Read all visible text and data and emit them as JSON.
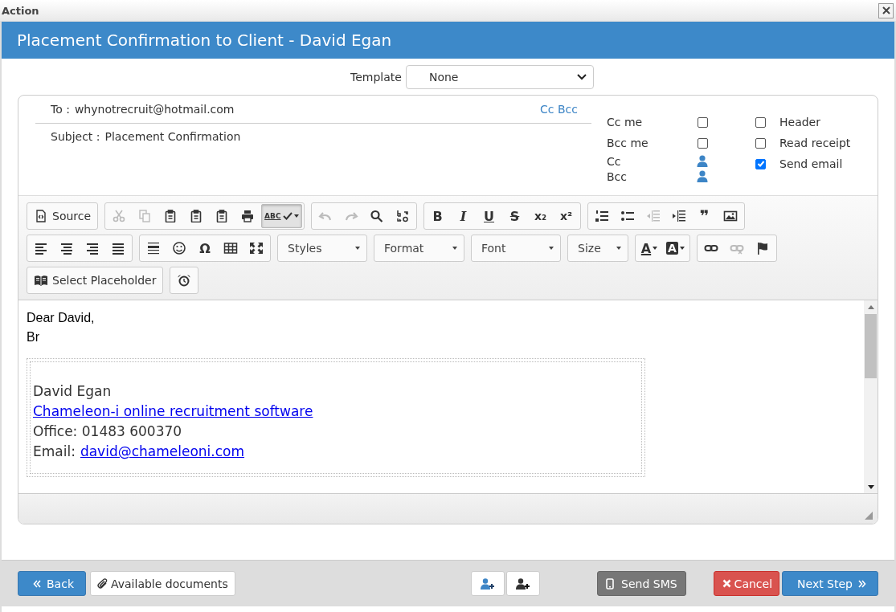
{
  "dialog": {
    "title": "Action"
  },
  "header": {
    "title": "Placement Confirmation to Client - David Egan"
  },
  "template": {
    "label": "Template",
    "value": "None"
  },
  "recipients": {
    "to_label": "To :",
    "to_value": "whynotrecruit@hotmail.com",
    "cc_bcc_link": "Cc Bcc",
    "subject_label": "Subject :",
    "subject_value": "Placement Confirmation"
  },
  "options_left": [
    {
      "label": "Cc me",
      "kind": "checkbox",
      "checked": false
    },
    {
      "label": "Bcc me",
      "kind": "checkbox",
      "checked": false
    },
    {
      "label": "Cc",
      "kind": "contact"
    },
    {
      "label": "Bcc",
      "kind": "contact"
    }
  ],
  "options_right": [
    {
      "label": "Header",
      "checked": false
    },
    {
      "label": "Read receipt",
      "checked": false
    },
    {
      "label": "Send email",
      "checked": true
    }
  ],
  "toolbar_rows": [
    [
      {
        "kind": "group",
        "items": [
          {
            "kind": "source",
            "label": "Source",
            "disabled": false,
            "on": false
          }
        ]
      },
      {
        "kind": "group",
        "items": [
          {
            "kind": "cut",
            "disabled": true,
            "on": false
          },
          {
            "kind": "copy",
            "disabled": true,
            "on": false
          },
          {
            "kind": "paste",
            "disabled": false,
            "on": false
          },
          {
            "kind": "paste-text",
            "disabled": false,
            "on": false
          },
          {
            "kind": "paste-word",
            "disabled": false,
            "on": false
          },
          {
            "kind": "print",
            "disabled": false,
            "on": false
          },
          {
            "kind": "spellcheck",
            "glyph": "ABC",
            "disabled": false,
            "on": true
          }
        ]
      },
      {
        "kind": "group",
        "items": [
          {
            "kind": "undo",
            "disabled": true,
            "on": false
          },
          {
            "kind": "redo",
            "disabled": true,
            "on": false
          },
          {
            "kind": "find",
            "disabled": false,
            "on": false
          },
          {
            "kind": "replace",
            "disabled": false,
            "on": false
          }
        ]
      },
      {
        "kind": "group",
        "items": [
          {
            "kind": "bold",
            "glyph": "B",
            "disabled": false,
            "on": false
          },
          {
            "kind": "italic",
            "glyph": "I",
            "disabled": false,
            "on": false
          },
          {
            "kind": "underline",
            "glyph": "U",
            "disabled": false,
            "on": false
          },
          {
            "kind": "strike",
            "glyph": "S",
            "disabled": false,
            "on": false
          },
          {
            "kind": "subscript",
            "glyph": "x₂",
            "disabled": false,
            "on": false
          },
          {
            "kind": "superscript",
            "glyph": "x²",
            "disabled": false,
            "on": false
          }
        ]
      },
      {
        "kind": "group",
        "items": [
          {
            "kind": "numbered-list",
            "disabled": false,
            "on": false
          },
          {
            "kind": "bullet-list",
            "disabled": false,
            "on": false
          },
          {
            "kind": "outdent",
            "disabled": true,
            "on": false
          },
          {
            "kind": "indent",
            "disabled": false,
            "on": false
          },
          {
            "kind": "quote",
            "glyph": "❞",
            "disabled": false,
            "on": false
          },
          {
            "kind": "image",
            "disabled": false,
            "on": false
          }
        ]
      }
    ],
    [
      {
        "kind": "group",
        "items": [
          {
            "kind": "align-left",
            "disabled": false,
            "on": false
          },
          {
            "kind": "align-center",
            "disabled": false,
            "on": false
          },
          {
            "kind": "align-right",
            "disabled": false,
            "on": false
          },
          {
            "kind": "justify",
            "disabled": false,
            "on": false
          }
        ]
      },
      {
        "kind": "group",
        "items": [
          {
            "kind": "rule",
            "disabled": false,
            "on": false
          },
          {
            "kind": "smiley",
            "disabled": false,
            "on": false
          },
          {
            "kind": "omega",
            "glyph": "Ω",
            "disabled": false,
            "on": false
          },
          {
            "kind": "table",
            "disabled": false,
            "on": false
          },
          {
            "kind": "maximize",
            "disabled": false,
            "on": false
          }
        ]
      },
      {
        "kind": "combo",
        "label": "Styles"
      },
      {
        "kind": "combo",
        "label": "Format"
      },
      {
        "kind": "combo",
        "label": "Font"
      },
      {
        "kind": "combo",
        "label": "Size"
      },
      {
        "kind": "group",
        "items": [
          {
            "kind": "text-color",
            "glyph": "A",
            "disabled": false,
            "on": false
          },
          {
            "kind": "background-color",
            "glyph": "A",
            "disabled": false,
            "on": false
          }
        ]
      },
      {
        "kind": "group",
        "items": [
          {
            "kind": "link",
            "disabled": false,
            "on": false
          },
          {
            "kind": "unlink",
            "disabled": true,
            "on": false
          },
          {
            "kind": "anchor",
            "disabled": false,
            "on": false
          }
        ]
      }
    ],
    [
      {
        "kind": "group",
        "items": [
          {
            "kind": "placeholder",
            "label": "Select Placeholder",
            "disabled": false,
            "on": false
          }
        ]
      },
      {
        "kind": "group",
        "items": [
          {
            "kind": "alarm",
            "disabled": false,
            "on": false
          }
        ]
      }
    ]
  ],
  "body": {
    "greeting": "Dear David,",
    "line_2": "Br",
    "signature": {
      "name": "David Egan",
      "company_link": "Chameleon-i online recruitment software",
      "office": "Office: 01483 600370",
      "email_label": "Email:",
      "email_link": "david@chameleoni.com"
    }
  },
  "footer": {
    "back": "Back",
    "documents": "Available documents",
    "send_sms": "Send SMS",
    "cancel": "Cancel",
    "next": "Next Step"
  }
}
